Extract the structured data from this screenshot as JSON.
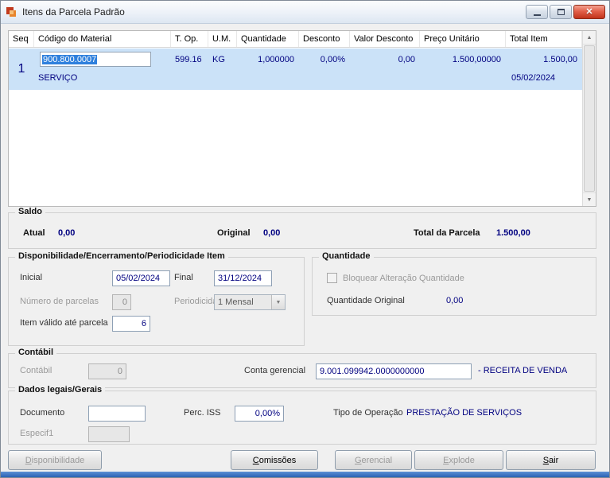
{
  "window": {
    "title": "Itens da Parcela Padrão"
  },
  "icons": {
    "close_glyph": "✕",
    "scroll_up": "▲",
    "scroll_down": "▼",
    "combo_arrow": "▼"
  },
  "colors": {
    "value_text": "#000080",
    "row_selection_bg": "#cbe2f8",
    "text_selection_bg": "#2f80dd",
    "close_button": "#c1331b",
    "bottom_strip": "#2a62b4"
  },
  "grid": {
    "columns": [
      "Seq",
      "Código do Material",
      "T. Op.",
      "U.M.",
      "Quantidade",
      "Desconto",
      "Valor Desconto",
      "Preço Unitário",
      "Total Item"
    ],
    "row": {
      "seq": "1",
      "codigo": "900.800.0007",
      "t_op": "599.16",
      "um": "KG",
      "quantidade": "1,000000",
      "desconto": "0,00%",
      "valor_desconto": "0,00",
      "preco_unitario": "1.500,00000",
      "total_item": "1.500,00",
      "descricao": "SERVIÇO",
      "data": "05/02/2024"
    }
  },
  "saldo": {
    "title": "Saldo",
    "atual_label": "Atual",
    "atual_value": "0,00",
    "original_label": "Original",
    "original_value": "0,00",
    "total_label": "Total da Parcela",
    "total_value": "1.500,00"
  },
  "disponibilidade": {
    "title": "Disponibilidade/Encerramento/Periodicidade Item",
    "inicial_label": "Inicial",
    "inicial_value": "05/02/2024",
    "final_label": "Final",
    "final_value": "31/12/2024",
    "num_parcelas_label": "Número de parcelas",
    "num_parcelas_value": "0",
    "periodicidade_label": "Periodicidade",
    "periodicidade_value": "1 Mensal",
    "item_valido_label": "Item válido até parcela",
    "item_valido_value": "6"
  },
  "quantidade": {
    "title": "Quantidade",
    "bloquear_label": "Bloquear Alteração Quantidade",
    "original_label": "Quantidade Original",
    "original_value": "0,00"
  },
  "contabil": {
    "title": "Contábil",
    "contabil_label": "Contábil",
    "contabil_value": "0",
    "conta_gerencial_label": "Conta gerencial",
    "conta_gerencial_value": "9.001.099942.0000000000",
    "conta_gerencial_desc": "- RECEITA DE VENDA"
  },
  "dados_legais": {
    "title": "Dados legais/Gerais",
    "documento_label": "Documento",
    "documento_value": "",
    "perc_iss_label": "Perc. ISS",
    "perc_iss_value": "0,00%",
    "tipo_operacao_label": "Tipo de Operação",
    "tipo_operacao_value": "PRESTAÇÃO DE SERVIÇOS",
    "especif1_label": "Especif1",
    "especif1_value": ""
  },
  "buttons": {
    "disponibilidade": "Disponibilidade",
    "comissoes": "Comissões",
    "gerencial": "Gerencial",
    "explode": "Explode",
    "sair": "Sair"
  }
}
